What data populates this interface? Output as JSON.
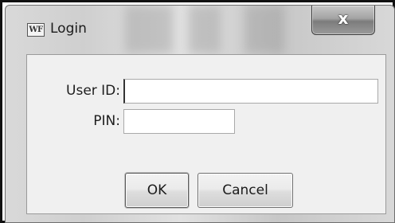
{
  "window": {
    "icon_text": "WF",
    "title": "Login",
    "close_glyph": "x"
  },
  "form": {
    "userid_label": "User ID:",
    "userid_value": "",
    "pin_label": "PIN:",
    "pin_value": ""
  },
  "buttons": {
    "ok_label": "OK",
    "cancel_label": "Cancel"
  }
}
